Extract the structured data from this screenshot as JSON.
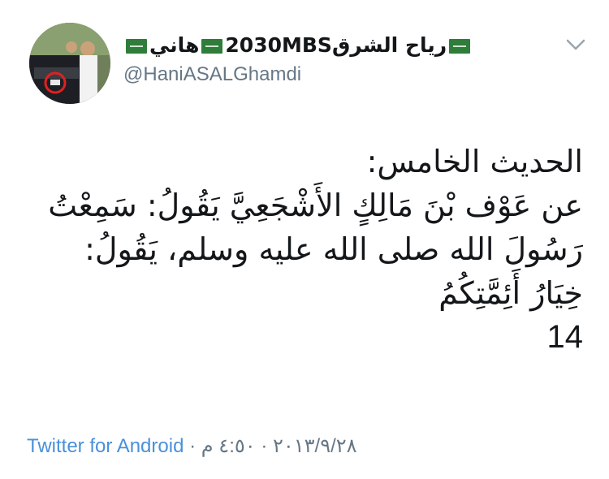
{
  "author": {
    "display_name": "رياح الشرق2030MBS",
    "display_name_suffix": "هاني",
    "handle": "@HaniASALGhamdi",
    "flag_icon": "saudi-flag-icon"
  },
  "tweet": {
    "lines": [
      "الحديث الخامس:",
      "عن عَوْف بْنَ مَالِكٍ الأَشْجَعِيَّ يَقُولُ: سَمِعْتُ",
      "رَسُولَ الله صلى الله عليه وسلم، يَقُولُ:",
      "خِيَارُ أَئِمَّتِكُمُ"
    ],
    "number": "14"
  },
  "footer": {
    "source": "Twitter for Android",
    "separator": "·",
    "date": "٢٠١٣/٩/٢٨",
    "time": "٤:٥٠ م"
  },
  "colors": {
    "link": "#4a90d9",
    "muted": "#657786",
    "text": "#14171a"
  }
}
